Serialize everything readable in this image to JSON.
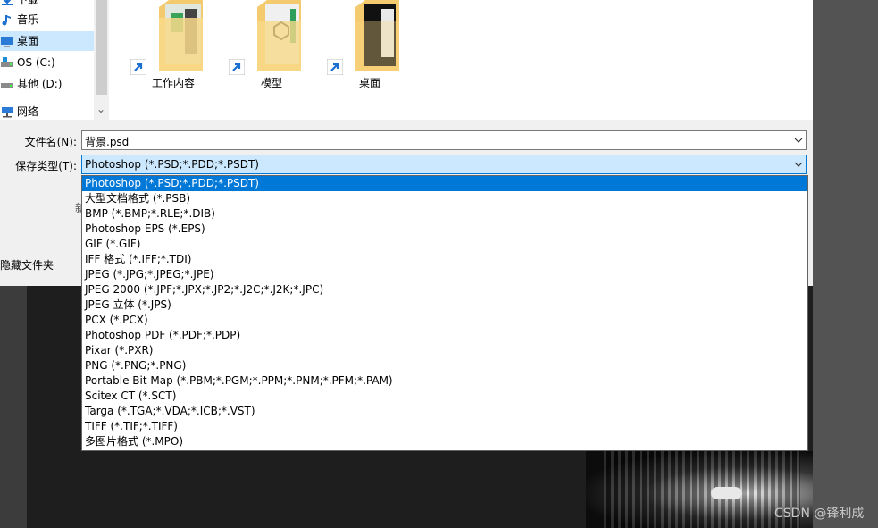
{
  "sidebar": {
    "items": [
      {
        "label": "下载",
        "icon": "download-icon"
      },
      {
        "label": "音乐",
        "icon": "music-icon"
      },
      {
        "label": "桌面",
        "icon": "desktop-icon",
        "selected": true
      },
      {
        "label": "OS (C:)",
        "icon": "drive-icon"
      },
      {
        "label": "其他 (D:)",
        "icon": "drive-icon"
      },
      {
        "label": "网络",
        "icon": "network-icon"
      }
    ]
  },
  "files": [
    {
      "name": "工作内容",
      "icon": "folder-shortcut-icon"
    },
    {
      "name": "模型",
      "icon": "folder-shortcut-icon"
    },
    {
      "name": "桌面",
      "icon": "folder-shortcut-icon"
    }
  ],
  "form": {
    "filename_label": "文件名(N):",
    "filename_value": "背景.psd",
    "filetype_label": "保存类型(T):",
    "filetype_value": "Photoshop (*.PSD;*.PDD;*.PSDT)",
    "partial_label": "新",
    "hide_folders": "隐藏文件夹"
  },
  "filetype_options": [
    "Photoshop (*.PSD;*.PDD;*.PSDT)",
    "大型文档格式 (*.PSB)",
    "BMP (*.BMP;*.RLE;*.DIB)",
    "Photoshop EPS (*.EPS)",
    "GIF (*.GIF)",
    "IFF 格式 (*.IFF;*.TDI)",
    "JPEG (*.JPG;*.JPEG;*.JPE)",
    "JPEG 2000 (*.JPF;*.JPX;*.JP2;*.J2C;*.J2K;*.JPC)",
    "JPEG 立体 (*.JPS)",
    "PCX (*.PCX)",
    "Photoshop PDF (*.PDF;*.PDP)",
    "Pixar (*.PXR)",
    "PNG (*.PNG;*.PNG)",
    "Portable Bit Map (*.PBM;*.PGM;*.PPM;*.PNM;*.PFM;*.PAM)",
    "Scitex CT (*.SCT)",
    "Targa (*.TGA;*.VDA;*.ICB;*.VST)",
    "TIFF (*.TIF;*.TIFF)",
    "多图片格式 (*.MPO)"
  ],
  "watermark": "CSDN @锋利成",
  "colors": {
    "selection": "#0078d7",
    "hover": "#cce8ff",
    "background_dark": "#1e1e1e"
  }
}
